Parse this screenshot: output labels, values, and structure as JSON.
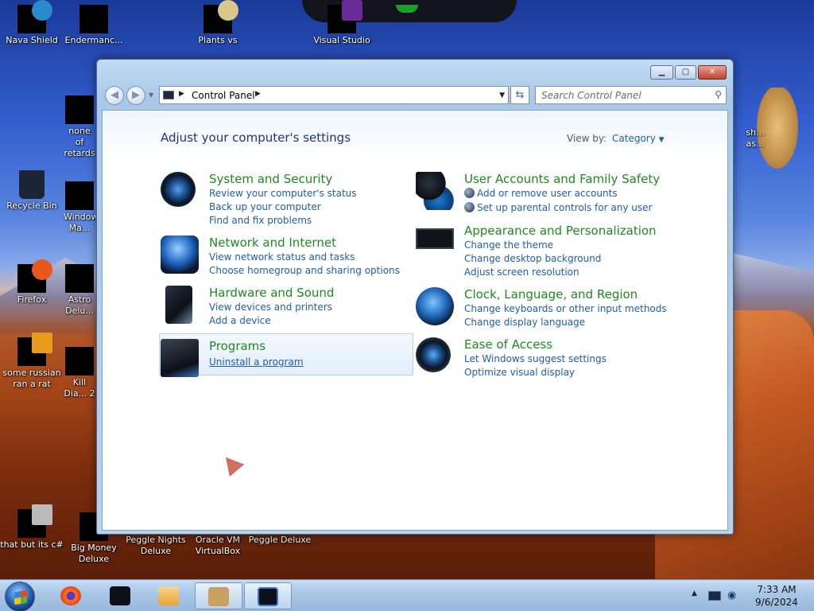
{
  "desktop": {
    "icons": [
      {
        "label": "Nava Shield"
      },
      {
        "label": "Endermanc..."
      },
      {
        "label": "Plants vs"
      },
      {
        "label": "Visual Studio"
      },
      {
        "label": "none of retards"
      },
      {
        "label": "Recycle Bin"
      },
      {
        "label": "Windows Ma..."
      },
      {
        "label": "Firefox"
      },
      {
        "label": "Astro Delu..."
      },
      {
        "label": "some russian ran a rat"
      },
      {
        "label": "Kill Dia... 2"
      },
      {
        "label": "that but its c#"
      },
      {
        "label": "Big Money Deluxe"
      },
      {
        "label": "Peggle Nights Deluxe"
      },
      {
        "label": "Oracle VM VirtualBox"
      },
      {
        "label": "Peggle Deluxe"
      },
      {
        "label": "sh... as..."
      }
    ]
  },
  "window": {
    "controls": {
      "minimize": "▁",
      "maximize": "▢",
      "close": "✕"
    },
    "address": {
      "location": "Control Panel"
    },
    "search": {
      "placeholder": "Search Control Panel"
    },
    "heading": "Adjust your computer's settings",
    "view_by": {
      "label": "View by:",
      "value": "Category"
    },
    "categories": {
      "system": {
        "title": "System and Security",
        "links": [
          "Review your computer's status",
          "Back up your computer",
          "Find and fix problems"
        ]
      },
      "network": {
        "title": "Network and Internet",
        "links": [
          "View network status and tasks",
          "Choose homegroup and sharing options"
        ]
      },
      "hardware": {
        "title": "Hardware and Sound",
        "links": [
          "View devices and printers",
          "Add a device"
        ]
      },
      "programs": {
        "title": "Programs",
        "links": [
          "Uninstall a program"
        ]
      },
      "users": {
        "title": "User Accounts and Family Safety",
        "links": [
          "Add or remove user accounts",
          "Set up parental controls for any user"
        ]
      },
      "appearance": {
        "title": "Appearance and Personalization",
        "links": [
          "Change the theme",
          "Change desktop background",
          "Adjust screen resolution"
        ]
      },
      "clock": {
        "title": "Clock, Language, and Region",
        "links": [
          "Change keyboards or other input methods",
          "Change display language"
        ]
      },
      "ease": {
        "title": "Ease of Access",
        "links": [
          "Let Windows suggest settings",
          "Optimize visual display"
        ]
      }
    }
  },
  "taskbar": {
    "clock": {
      "time": "7:33 AM",
      "date": "9/6/2024"
    }
  }
}
